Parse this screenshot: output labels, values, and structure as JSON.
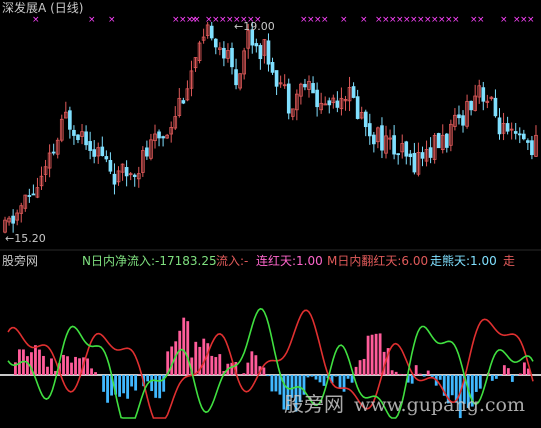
{
  "title": {
    "name": "深发展",
    "code": "A",
    "period": "(日线)"
  },
  "price_panel": {
    "high_label": "19.00",
    "low_label": "15.20",
    "high_arrow": "←",
    "low_arrow": "←"
  },
  "indicator_bar": {
    "site_name": "股旁网",
    "items": [
      {
        "label": "N日内净流入:",
        "value": "-17183.25",
        "color": "#7fe07f"
      },
      {
        "label": "流入:",
        "value": "-",
        "color": "#e05a5a"
      },
      {
        "label": "连红天:",
        "value": "1.00",
        "color": "#ff66cc"
      },
      {
        "label": "M日内翻红天:",
        "value": "6.00",
        "color": "#e05a5a"
      },
      {
        "label": "走熊天:",
        "value": "1.00",
        "color": "#80e0ff"
      },
      {
        "label": "走",
        "value": "",
        "color": "#e05a5a"
      }
    ]
  },
  "watermark": {
    "brand": "股旁网",
    "url": "www.gupang.com"
  },
  "colors": {
    "background": "#000000",
    "up_candle": "#e05a5a",
    "down_candle": "#80e0ff",
    "marker": "#ff44ff",
    "line_red": "#e03030",
    "line_green": "#40e040",
    "hist_pos": "#ff5c9a",
    "hist_neg": "#40b8ff",
    "zero_line": "#c8c8c8"
  }
}
